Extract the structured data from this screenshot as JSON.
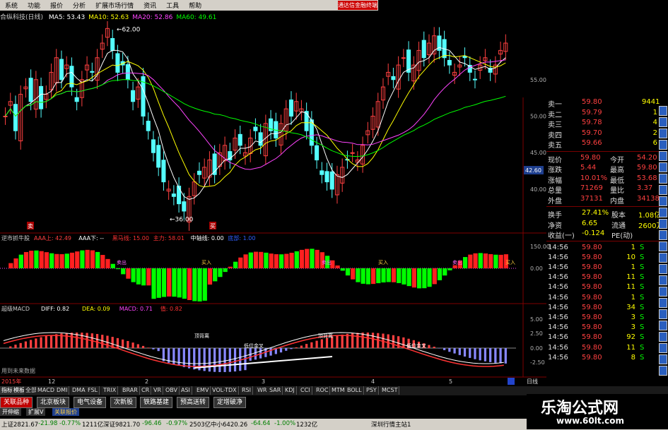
{
  "menu": {
    "items": [
      "系统",
      "功能",
      "报价",
      "分析",
      "扩展市场行情",
      "资讯",
      "工具",
      "帮助"
    ],
    "right_label": "通达信金融终端"
  },
  "stock": {
    "name": "合纵科技(日线)",
    "ma": [
      {
        "label": "MA5: 53.43",
        "color": "#ffffff"
      },
      {
        "label": "MA10: 52.63",
        "color": "#ffff00"
      },
      {
        "label": "MA20: 52.86",
        "color": "#ff44ff"
      },
      {
        "label": "MA60: 49.61",
        "color": "#00ff00"
      }
    ],
    "price_high": "62.00",
    "price_low": "36.00",
    "current_axis_price": "42.60",
    "markers": [
      "卖",
      "买"
    ]
  },
  "axis_price": {
    "ticks": [
      "55.00",
      "50.00",
      "45.00",
      "40.00"
    ]
  },
  "indicator1": {
    "title": "逆市抓牛股",
    "legend": [
      {
        "label": "AAA上: 42.49",
        "color": "#ff4040"
      },
      {
        "label": "AAA下: --",
        "color": "#ffffff"
      },
      {
        "label": "黑马线: 15.00",
        "color": "#ff3333"
      },
      {
        "label": "主力: 58.01",
        "color": "#ff3333"
      },
      {
        "label": "中轴线: 0.00",
        "color": "#ffffff"
      },
      {
        "label": "底部: 1.00",
        "color": "#3060ff"
      }
    ],
    "ticks": [
      "150.00",
      "0.00"
    ],
    "labels": [
      "卖出",
      "买入",
      "卖出",
      "买入",
      "卖出",
      "买入"
    ]
  },
  "indicator2": {
    "title": "超级MACD",
    "legend": [
      {
        "label": "DIFF: 0.82",
        "color": "#ffffff"
      },
      {
        "label": "DEA: 0.09",
        "color": "#ffff00"
      },
      {
        "label": "MACD: 0.71",
        "color": "#ff44ff"
      },
      {
        "label": "值: 0.82",
        "color": "#ff3333"
      }
    ],
    "ticks": [
      "5.00",
      "2.50",
      "0.00",
      "-2.50"
    ],
    "annotations": [
      "顶背离",
      "低位金叉",
      "顶背离",
      "低位金叉"
    ],
    "footer_note": "用到未来数据"
  },
  "x_axis": {
    "year": "2015年",
    "months": [
      "12",
      "2",
      "3",
      "4",
      "5"
    ],
    "cycle": "日线"
  },
  "quote": {
    "order_book": [
      {
        "label": "卖一",
        "price": "59.80",
        "vol": "9441"
      },
      {
        "label": "卖二",
        "price": "59.79",
        "vol": "1"
      },
      {
        "label": "卖三",
        "price": "59.78",
        "vol": "4"
      },
      {
        "label": "卖四",
        "price": "59.70",
        "vol": "2"
      },
      {
        "label": "卖五",
        "price": "59.66",
        "vol": "6"
      }
    ],
    "stats": [
      {
        "l1": "现价",
        "v1": "59.80",
        "l2": "今开",
        "v2": "54.20"
      },
      {
        "l1": "涨跌",
        "v1": "5.44",
        "l2": "最高",
        "v2": "59.80"
      },
      {
        "l1": "涨幅",
        "v1": "10.01%",
        "l2": "最低",
        "v2": "53.68"
      },
      {
        "l1": "总量",
        "v1": "71269",
        "l2": "量比",
        "v2": "3.37"
      },
      {
        "l1": "外盘",
        "v1": "37131",
        "l2": "内盘",
        "v2": "34138"
      }
    ],
    "stats2": [
      {
        "l1": "换手",
        "v1": "27.41%",
        "l2": "股本",
        "v2": "1.08亿"
      },
      {
        "l1": "净资",
        "v1": "6.65",
        "l2": "流通",
        "v2": "2600万"
      },
      {
        "l1": "收益(一)",
        "v1": "-0.124",
        "l2": "PE(动)",
        "v2": ""
      }
    ],
    "trades": [
      {
        "t": "14:56",
        "p": "59.80",
        "v": "1",
        "f": "S"
      },
      {
        "t": "14:56",
        "p": "59.80",
        "v": "10",
        "f": "S"
      },
      {
        "t": "14:56",
        "p": "59.80",
        "v": "1",
        "f": "S"
      },
      {
        "t": "14:56",
        "p": "59.80",
        "v": "11",
        "f": "S"
      },
      {
        "t": "14:56",
        "p": "59.80",
        "v": "11",
        "f": "S"
      },
      {
        "t": "14:56",
        "p": "59.80",
        "v": "1",
        "f": "S"
      },
      {
        "t": "14:56",
        "p": "59.80",
        "v": "34",
        "f": "S"
      },
      {
        "t": "14:56",
        "p": "59.80",
        "v": "3",
        "f": "S"
      },
      {
        "t": "14:56",
        "p": "59.80",
        "v": "3",
        "f": "S"
      },
      {
        "t": "14:56",
        "p": "59.80",
        "v": "92",
        "f": "S"
      },
      {
        "t": "14:56",
        "p": "59.80",
        "v": "11",
        "f": "S"
      },
      {
        "t": "14:56",
        "p": "59.80",
        "v": "8",
        "f": "S"
      }
    ]
  },
  "indicator_tabs": [
    "指标",
    "模板",
    "全部",
    "MACD",
    "DMI",
    "DMA",
    "FSL",
    "TRIX",
    "BRAR",
    "CR",
    "VR",
    "OBV",
    "ASI",
    "EMV",
    "VOL-TDX",
    "RSI",
    "WR",
    "SAR",
    "KDJ",
    "CCI",
    "ROC",
    "MTM",
    "BOLL",
    "PSY",
    "MCST"
  ],
  "sector_tabs": [
    "关联品种",
    "北京板块",
    "电气设备",
    "次新股",
    "铁路基建",
    "预高送转",
    "定增破净"
  ],
  "bottom_tabs": [
    "开伸缩",
    "扩展V",
    "关联报价"
  ],
  "status": [
    {
      "text": "上证2821.67",
      "color": "#000"
    },
    {
      "text": "-21.98",
      "color": "#008000"
    },
    {
      "text": "-0.77%",
      "color": "#008000"
    },
    {
      "text": "1211亿",
      "color": "#000"
    },
    {
      "text": "深证9821.70",
      "color": "#000"
    },
    {
      "text": "-96.46",
      "color": "#008000"
    },
    {
      "text": "-0.97%",
      "color": "#008000"
    },
    {
      "text": "2503亿",
      "color": "#000"
    },
    {
      "text": "中小6420.26",
      "color": "#000"
    },
    {
      "text": "-64.64",
      "color": "#008000"
    },
    {
      "text": "-1.00%",
      "color": "#008000"
    },
    {
      "text": "1232亿",
      "color": "#000"
    },
    {
      "text": "深圳行情主站1",
      "color": "#000"
    }
  ],
  "watermark": {
    "title": "乐淘公式网",
    "url": "www.60lt.com"
  }
}
